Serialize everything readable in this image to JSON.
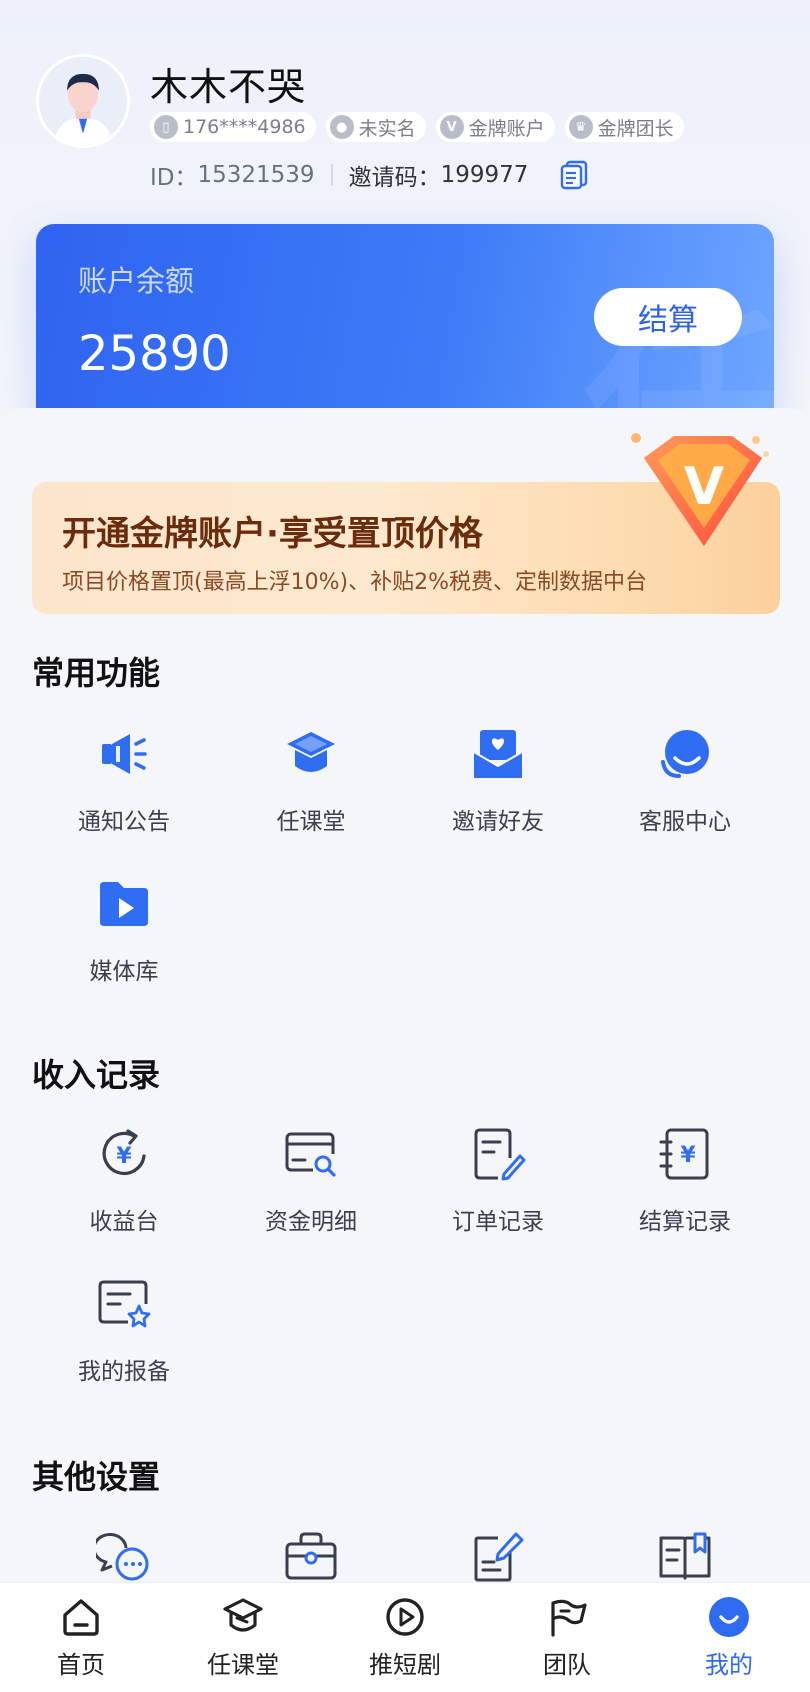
{
  "profile": {
    "name": "木木不哭",
    "phone": "176****4986",
    "tags": [
      "未实名",
      "金牌账户",
      "金牌团长"
    ],
    "id_label": "ID：",
    "id_value": "15321539",
    "invite_label": "邀请码：",
    "invite_value": "199977"
  },
  "balance": {
    "label": "账户余额",
    "value": "25890",
    "watermark": "任",
    "settle_label": "结算"
  },
  "promo": {
    "title": "开通金牌账户·享受置顶价格",
    "subtitle": "项目价格置顶(最高上浮10%)、补贴2%税费、定制数据中台",
    "badge_letter": "V"
  },
  "sections": {
    "common": {
      "title": "常用功能",
      "items": [
        {
          "label": "通知公告",
          "icon": "megaphone-icon"
        },
        {
          "label": "任课堂",
          "icon": "graduation-cap-icon"
        },
        {
          "label": "邀请好友",
          "icon": "invite-envelope-icon"
        },
        {
          "label": "客服中心",
          "icon": "customer-service-icon"
        },
        {
          "label": "媒体库",
          "icon": "media-folder-icon"
        }
      ]
    },
    "income": {
      "title": "收入记录",
      "items": [
        {
          "label": "收益台",
          "icon": "yuan-refresh-icon"
        },
        {
          "label": "资金明细",
          "icon": "card-search-icon"
        },
        {
          "label": "订单记录",
          "icon": "document-edit-icon"
        },
        {
          "label": "结算记录",
          "icon": "yuan-ledger-icon"
        },
        {
          "label": "我的报备",
          "icon": "report-star-icon"
        }
      ]
    },
    "other": {
      "title": "其他设置",
      "items": [
        {
          "icon": "chat-bubbles-icon"
        },
        {
          "icon": "briefcase-icon"
        },
        {
          "icon": "note-pen-icon"
        },
        {
          "icon": "open-book-icon"
        }
      ]
    }
  },
  "nav": [
    {
      "label": "首页",
      "icon": "home-icon"
    },
    {
      "label": "任课堂",
      "icon": "graduation-cap-icon"
    },
    {
      "label": "推短剧",
      "icon": "play-circle-icon"
    },
    {
      "label": "团队",
      "icon": "flag-icon"
    },
    {
      "label": "我的",
      "icon": "smile-icon",
      "active": true
    }
  ],
  "colors": {
    "primary": "#2e6bf0",
    "icon_blue": "#2f6df3",
    "card_gradient_start": "#2f63f0",
    "card_gradient_end": "#6ea6ff",
    "promo_text": "#6a2c0c",
    "badge_orange": "#ff7a3d"
  }
}
